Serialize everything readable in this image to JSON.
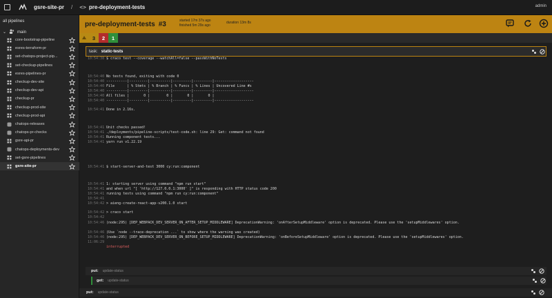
{
  "topbar": {
    "pipeline": "gsre-site-pr",
    "separator": "/",
    "job_prefix": "<>",
    "job": "pre-deployment-tests",
    "user": "admin"
  },
  "sidebar": {
    "all_label": "all pipelines",
    "team": "main",
    "items": [
      {
        "name": "core-bootstrap-pipeline"
      },
      {
        "name": "esres-terraform-pr"
      },
      {
        "name": "set-chatops-project-pip..."
      },
      {
        "name": "set-checkup-pipelines"
      },
      {
        "name": "esres-pipelines-pr"
      },
      {
        "name": "checkup-dev-site"
      },
      {
        "name": "checkup-dev-api"
      },
      {
        "name": "checkup-pr"
      },
      {
        "name": "checkup-prod-site"
      },
      {
        "name": "checkup-prod-api"
      },
      {
        "name": "chatops-releases"
      },
      {
        "name": "chatops-pr-checks"
      },
      {
        "name": "gsre-api-pr"
      },
      {
        "name": "chatops-deployments-dev"
      },
      {
        "name": "set-gsre-pipelines"
      },
      {
        "name": "gsre-site-pr"
      }
    ]
  },
  "header": {
    "job": "pre-deployment-tests",
    "build": "#3",
    "started": "started 17m 37s ago",
    "finished": "finished 5m 29s ago",
    "duration": "duration 13m 8s"
  },
  "tabs": [
    "3",
    "2",
    "1"
  ],
  "task": {
    "label": "task:",
    "name": "static-tests"
  },
  "log": [
    {
      "ts": "10:54:38",
      "text": "$ craco test --coverage --watchAll=false --passWithNoTests"
    },
    {
      "ts": "",
      "text": ""
    },
    {
      "ts": "10:54:40",
      "text": "No tests found, exiting with code 0"
    },
    {
      "ts": "10:54:40",
      "text": "----------|---------|----------|---------|---------|-------------------"
    },
    {
      "ts": "10:54:40",
      "text": "File      | % Stmts | % Branch | % Funcs | % Lines | Uncovered Line #s"
    },
    {
      "ts": "10:54:40",
      "text": "----------|---------|----------|---------|---------|-------------------"
    },
    {
      "ts": "10:54:40",
      "text": "All files |       0 |        0 |       0 |       0 |"
    },
    {
      "ts": "10:54:40",
      "text": "----------|---------|----------|---------|---------|-------------------"
    },
    {
      "ts": "10:54:41",
      "text": "Done in 2.16s."
    },
    {
      "ts": "",
      "text": ""
    },
    {
      "ts": "10:54:41",
      "text": "Unit checks passed!"
    },
    {
      "ts": "10:54:41",
      "text": "./deployments/pipeline-scripts/test-code.sh: line 29: Get: command not found"
    },
    {
      "ts": "10:54:41",
      "text": "Running component tests..."
    },
    {
      "ts": "10:54:41",
      "text": "yarn run v1.22.19"
    },
    {
      "ts": "",
      "text": ""
    },
    {
      "ts": "10:54:41",
      "text": "$ start-server-and-test 3000 cy:run:component"
    },
    {
      "ts": "",
      "text": ""
    },
    {
      "ts": "10:54:41",
      "text": "1: starting server using command \"npm run start\""
    },
    {
      "ts": "10:54:41",
      "text": "and when url \"[ 'http://127.0.0.1:3000' ]\" is responding with HTTP status code 200"
    },
    {
      "ts": "10:54:41",
      "text": "running tests using command \"npm run cy:run:component\""
    },
    {
      "ts": "10:54:41",
      "text": ""
    },
    {
      "ts": "10:54:42",
      "text": "> aieng-create-react-app-v200.1.0 start"
    },
    {
      "ts": "10:54:42",
      "text": "> craco start"
    },
    {
      "ts": "10:54:42",
      "text": ""
    },
    {
      "ts": "10:54:46",
      "text": "(node:295) [DEP_WEBPACK_DEV_SERVER_ON_AFTER_SETUP_MIDDLEWARE] DeprecationWarning: 'onAfterSetupMiddleware' option is deprecated. Please use the 'setupMiddlewares' option."
    },
    {
      "ts": "10:54:46",
      "text": "(Use `node --trace-deprecation ...` to show where the warning was created)"
    },
    {
      "ts": "10:54:46",
      "text": "(node:295) [DEP_WEBPACK_DEV_SERVER_ON_BEFORE_SETUP_MIDDLEWARE] DeprecationWarning: 'onBeforeSetupMiddleware' option is deprecated. Please use the 'setupMiddlewares' option."
    },
    {
      "ts": "11:06:29",
      "text": ""
    },
    {
      "ts": "",
      "text": "interrupted",
      "red": true
    }
  ],
  "steps": [
    {
      "key": "put:",
      "value": "update-status"
    },
    {
      "key": "get:",
      "value": "update-status"
    },
    {
      "key": "put:",
      "value": "update-status"
    }
  ],
  "colors": {
    "accent": "#bd8412",
    "tab_yellow": "#b88a14",
    "tab_red": "#b22c2c",
    "tab_green": "#2f8f3a"
  }
}
